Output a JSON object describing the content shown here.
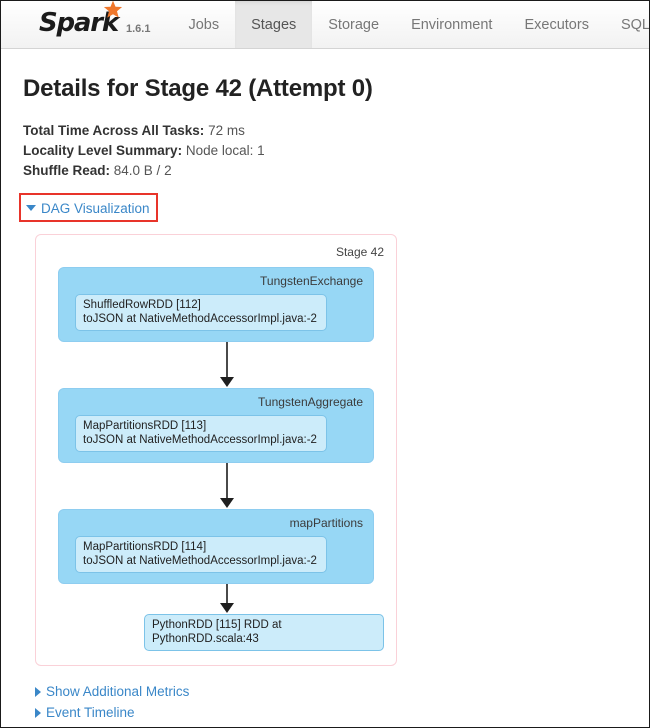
{
  "navbar": {
    "brand": "Spark",
    "version": "1.6.1",
    "logo_icon": "spark-star-icon",
    "tabs": [
      {
        "label": "Jobs",
        "active": false
      },
      {
        "label": "Stages",
        "active": true
      },
      {
        "label": "Storage",
        "active": false
      },
      {
        "label": "Environment",
        "active": false
      },
      {
        "label": "Executors",
        "active": false
      },
      {
        "label": "SQL",
        "active": false
      }
    ]
  },
  "header": {
    "title": "Details for Stage 42 (Attempt 0)"
  },
  "summary": [
    {
      "label": "Total Time Across All Tasks:",
      "value": "72 ms"
    },
    {
      "label": "Locality Level Summary:",
      "value": "Node local: 1"
    },
    {
      "label": "Shuffle Read:",
      "value": "84.0 B / 2"
    }
  ],
  "dag_toggle": {
    "label": "DAG Visualization",
    "caret_icon": "caret-down-icon",
    "expanded": true,
    "highlight_color": "#e8342a"
  },
  "dag": {
    "stage_label": "Stage 42",
    "container_border_color": "#fad1d8",
    "scope_color": "#97d7f5",
    "node_color": "#ccecfa",
    "scopes": [
      {
        "label": "TungstenExchange",
        "node": {
          "line1": "ShuffledRowRDD [112]",
          "line2": "toJSON at NativeMethodAccessorImpl.java:-2"
        }
      },
      {
        "label": "TungstenAggregate",
        "node": {
          "line1": "MapPartitionsRDD [113]",
          "line2": "toJSON at NativeMethodAccessorImpl.java:-2"
        }
      },
      {
        "label": "mapPartitions",
        "node": {
          "line1": "MapPartitionsRDD [114]",
          "line2": "toJSON at NativeMethodAccessorImpl.java:-2"
        }
      }
    ],
    "final_node": {
      "line1": "PythonRDD [115]",
      "line2": "RDD at PythonRDD.scala:43"
    }
  },
  "footer": {
    "links": [
      {
        "label": "Show Additional Metrics",
        "caret_icon": "caret-right-icon"
      },
      {
        "label": "Event Timeline",
        "caret_icon": "caret-right-icon"
      }
    ]
  }
}
